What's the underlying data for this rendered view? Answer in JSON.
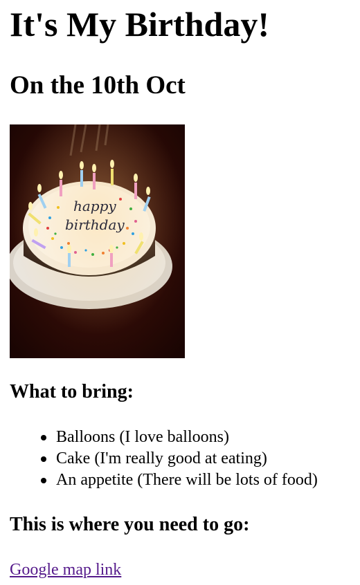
{
  "page": {
    "title": "It's My Birthday!",
    "subtitle": "On the 10th Oct"
  },
  "photo": {
    "cake_text_line1": "happy",
    "cake_text_line2": "birthday"
  },
  "bring": {
    "heading": "What to bring:",
    "items": [
      "Balloons (I love balloons)",
      "Cake (I'm really good at eating)",
      "An appetite (There will be lots of food)"
    ]
  },
  "location": {
    "heading": "This is where you need to go:",
    "link_label": "Google map link"
  },
  "colors": {
    "link_visited": "#551a8b",
    "text": "#000000",
    "background": "#ffffff"
  }
}
